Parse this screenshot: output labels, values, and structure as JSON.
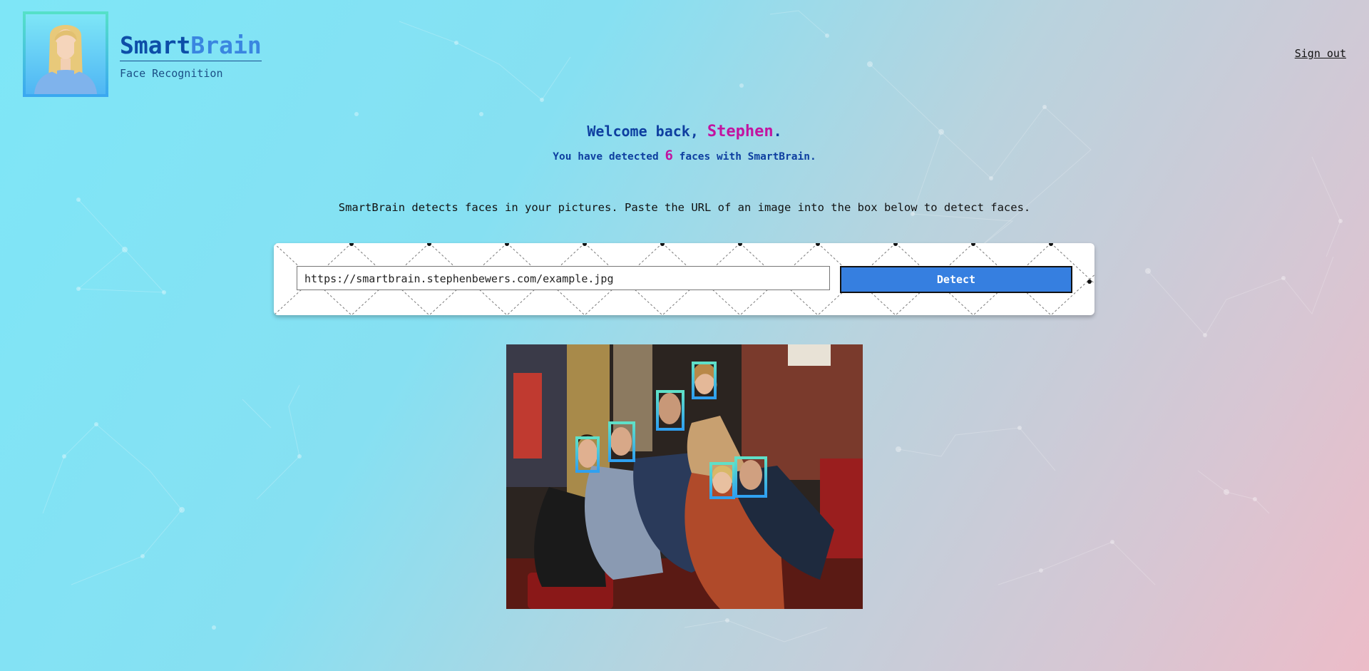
{
  "app": {
    "brand_part1": "Smart",
    "brand_part2": "Brain",
    "subtitle": "Face Recognition",
    "sign_out": "Sign out"
  },
  "welcome": {
    "prefix": "Welcome back, ",
    "name": "Stephen",
    "suffix": ".",
    "count_prefix": "You have detected ",
    "count": "6",
    "count_suffix": " faces with SmartBrain."
  },
  "description": "SmartBrain detects faces in your pictures. Paste the URL of an image into the box below to detect faces.",
  "form": {
    "url_value": "https://smartbrain.stephenbewers.com/example.jpg",
    "detect_label": "Detect"
  },
  "result": {
    "faces_detected": 6
  },
  "colors": {
    "brand_dark": "#0d4ea8",
    "brand_light": "#3a86e0",
    "accent_magenta": "#c214a0",
    "button_blue": "#367fe0"
  },
  "icons": {
    "avatar": "avatar-icon"
  }
}
